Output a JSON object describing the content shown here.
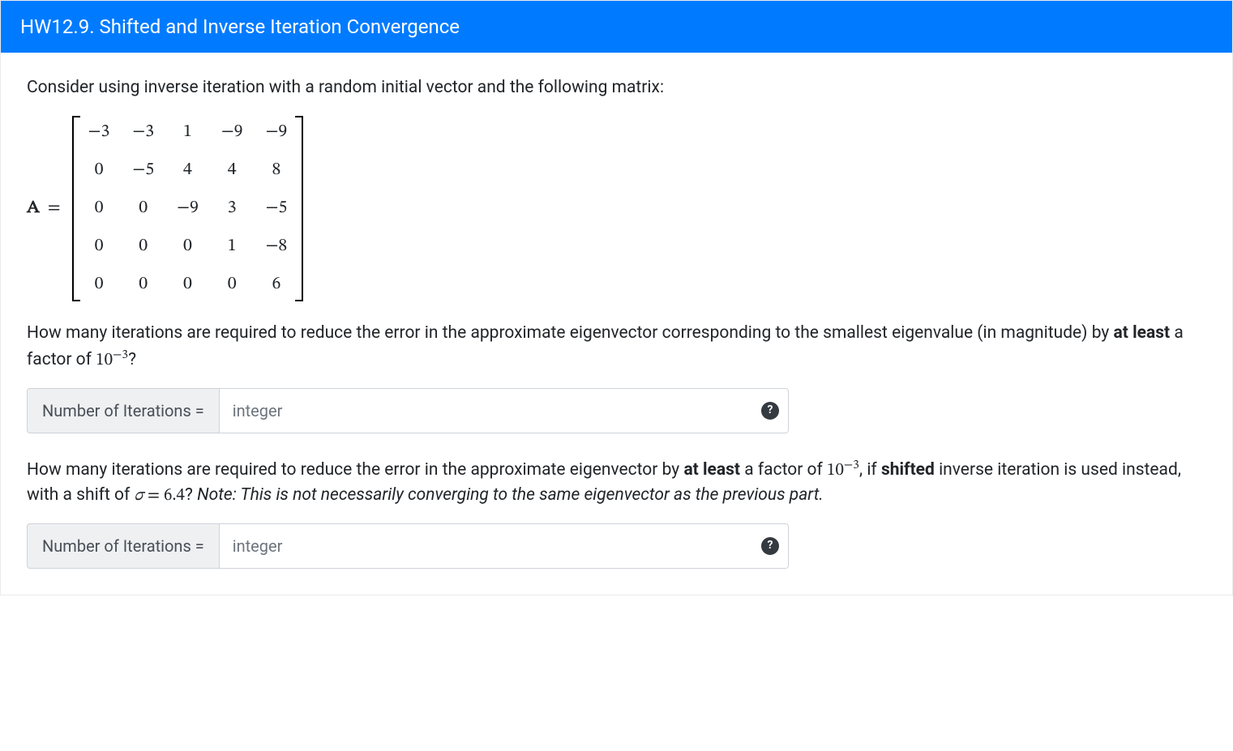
{
  "header": {
    "title": "HW12.9. Shifted and Inverse Iteration Convergence"
  },
  "body": {
    "intro": "Consider using inverse iteration with a random initial vector and the following matrix:",
    "matrix_label": "A",
    "matrix_eq": "=",
    "matrix": [
      [
        "−3",
        "−3",
        "1",
        "−9",
        "−9"
      ],
      [
        "0",
        "−5",
        "4",
        "4",
        "8"
      ],
      [
        "0",
        "0",
        "−9",
        "3",
        "−5"
      ],
      [
        "0",
        "0",
        "0",
        "1",
        "−8"
      ],
      [
        "0",
        "0",
        "0",
        "0",
        "6"
      ]
    ],
    "q1_part1": "How many iterations are required to reduce the error in the approximate eigenvector corresponding to the smallest eigenvalue (in magnitude) by ",
    "q1_bold": "at least",
    "q1_part2": " a factor of ",
    "q1_math_base": "10",
    "q1_math_exp": "−3",
    "q1_part3": "?",
    "q2_part1": "How many iterations are required to reduce the error in the approximate eigenvector by ",
    "q2_bold1": "at least",
    "q2_part2": " a factor of ",
    "q2_math_base": "10",
    "q2_math_exp": "−3",
    "q2_part3": ", if ",
    "q2_bold2": "shifted",
    "q2_part4": " inverse iteration is used instead, with a shift of ",
    "q2_sigma": "σ",
    "q2_eq": " = ",
    "q2_sigma_val": "6.4",
    "q2_part5": "? ",
    "q2_note": "Note: This is not necessarily converging to the same eigenvector as the previous part."
  },
  "inputs": {
    "label": "Number of Iterations =",
    "placeholder": "integer",
    "help": "?"
  }
}
